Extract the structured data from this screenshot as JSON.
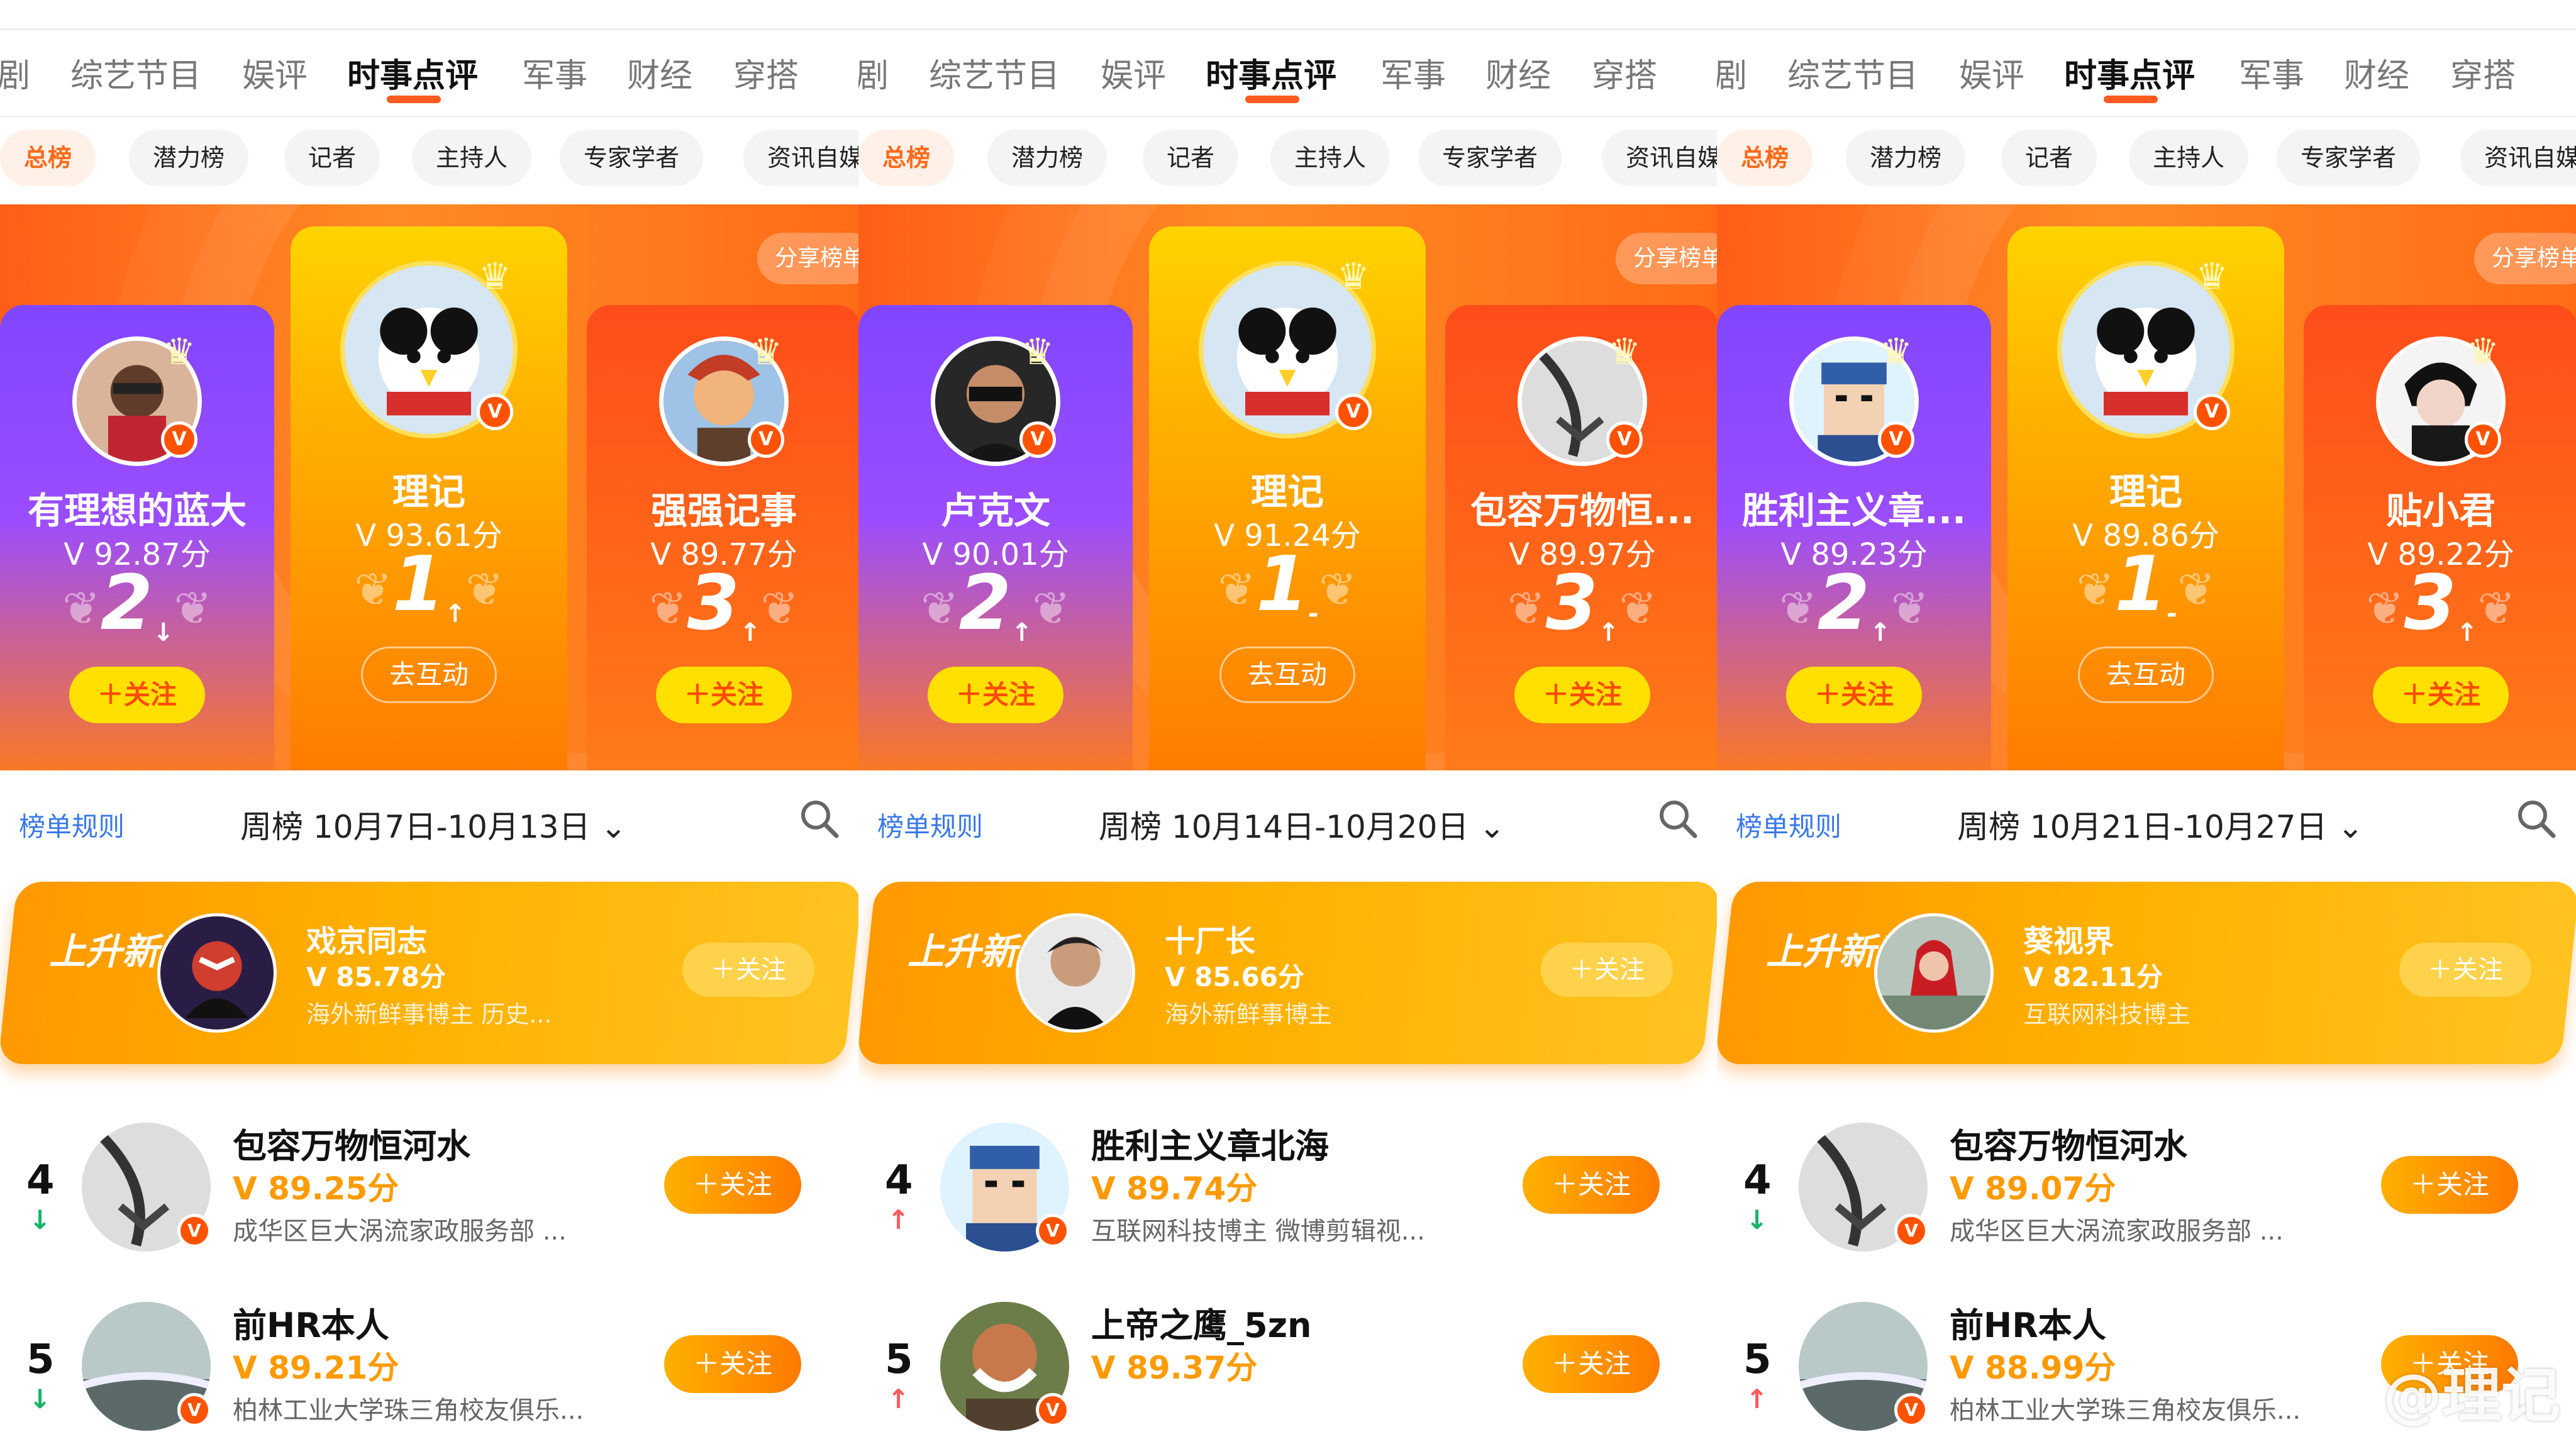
{
  "panels": [
    {
      "tabs": [
        "剧",
        "综艺节目",
        "娱评",
        "时事点评",
        "军事",
        "财经",
        "穿搭"
      ],
      "chips": [
        "总榜",
        "潜力榜",
        "记者",
        "主持人",
        "专家学者",
        "资讯自媒体"
      ],
      "share": "分享榜单",
      "podium": {
        "left": {
          "name": "有理想的蓝大",
          "score": "92.87分",
          "rank": "2",
          "trend": "↓",
          "button": "＋关注"
        },
        "mid": {
          "name": "理记",
          "score": "93.61分",
          "rank": "1",
          "trend": "↑",
          "button": "去互动"
        },
        "right": {
          "name": "强强记事",
          "score": "89.77分",
          "rank": "3",
          "trend": "↑",
          "button": "＋关注"
        }
      },
      "rule": "榜单规则",
      "week": "周榜  10月7日-10月13日",
      "new": {
        "tag": "上升新秀",
        "name": "戏京同志",
        "score": "85.78分",
        "desc": "海外新鲜事博主 历史...",
        "button": "＋关注"
      },
      "rows": [
        {
          "rank": "4",
          "trend": "↓",
          "trend_color": "#18b36b",
          "name": "包容万物恒河水",
          "score": "89.25分",
          "desc": "成华区巨大涡流家政服务部 ...",
          "button": "＋关注"
        },
        {
          "rank": "5",
          "trend": "↓",
          "trend_color": "#18b36b",
          "name": "前HR本人",
          "score": "89.21分",
          "desc": "柏林工业大学珠三角校友俱乐...",
          "button": "＋关注"
        }
      ]
    },
    {
      "tabs": [
        "剧",
        "综艺节目",
        "娱评",
        "时事点评",
        "军事",
        "财经",
        "穿搭"
      ],
      "chips": [
        "总榜",
        "潜力榜",
        "记者",
        "主持人",
        "专家学者",
        "资讯自媒体"
      ],
      "share": "分享榜单",
      "podium": {
        "left": {
          "name": "卢克文",
          "score": "90.01分",
          "rank": "2",
          "trend": "↑",
          "button": "＋关注"
        },
        "mid": {
          "name": "理记",
          "score": "91.24分",
          "rank": "1",
          "trend": "-",
          "button": "去互动"
        },
        "right": {
          "name": "包容万物恒...",
          "score": "89.97分",
          "rank": "3",
          "trend": "↑",
          "button": "＋关注"
        }
      },
      "rule": "榜单规则",
      "week": "周榜  10月14日-10月20日",
      "new": {
        "tag": "上升新秀",
        "name": "十厂长",
        "score": "85.66分",
        "desc": "海外新鲜事博主",
        "button": "＋关注"
      },
      "rows": [
        {
          "rank": "4",
          "trend": "↑",
          "trend_color": "#ff5a5a",
          "name": "胜利主义章北海",
          "score": "89.74分",
          "desc": "互联网科技博主 微博剪辑视...",
          "button": "＋关注"
        },
        {
          "rank": "5",
          "trend": "↑",
          "trend_color": "#ff5a5a",
          "name": "上帝之鹰_5zn",
          "score": "89.37分",
          "desc": "",
          "button": "＋关注"
        }
      ]
    },
    {
      "tabs": [
        "剧",
        "综艺节目",
        "娱评",
        "时事点评",
        "军事",
        "财经",
        "穿搭"
      ],
      "chips": [
        "总榜",
        "潜力榜",
        "记者",
        "主持人",
        "专家学者",
        "资讯自媒体"
      ],
      "share": "分享榜单",
      "podium": {
        "left": {
          "name": "胜利主义章...",
          "score": "89.23分",
          "rank": "2",
          "trend": "↑",
          "button": "＋关注"
        },
        "mid": {
          "name": "理记",
          "score": "89.86分",
          "rank": "1",
          "trend": "-",
          "button": "去互动"
        },
        "right": {
          "name": "贴小君",
          "score": "89.22分",
          "rank": "3",
          "trend": "↑",
          "button": "＋关注"
        }
      },
      "rule": "榜单规则",
      "week": "周榜  10月21日-10月27日",
      "new": {
        "tag": "上升新秀",
        "name": "葵视界",
        "score": "82.11分",
        "desc": "互联网科技博主",
        "button": "＋关注"
      },
      "rows": [
        {
          "rank": "4",
          "trend": "↓",
          "trend_color": "#18b36b",
          "name": "包容万物恒河水",
          "score": "89.07分",
          "desc": "成华区巨大涡流家政服务部 ...",
          "button": "＋关注"
        },
        {
          "rank": "5",
          "trend": "↑",
          "trend_color": "#ff5a5a",
          "name": "前HR本人",
          "score": "88.99分",
          "desc": "柏林工业大学珠三角校友俱乐...",
          "button": "＋关注"
        }
      ]
    }
  ],
  "watermark": "@理记"
}
